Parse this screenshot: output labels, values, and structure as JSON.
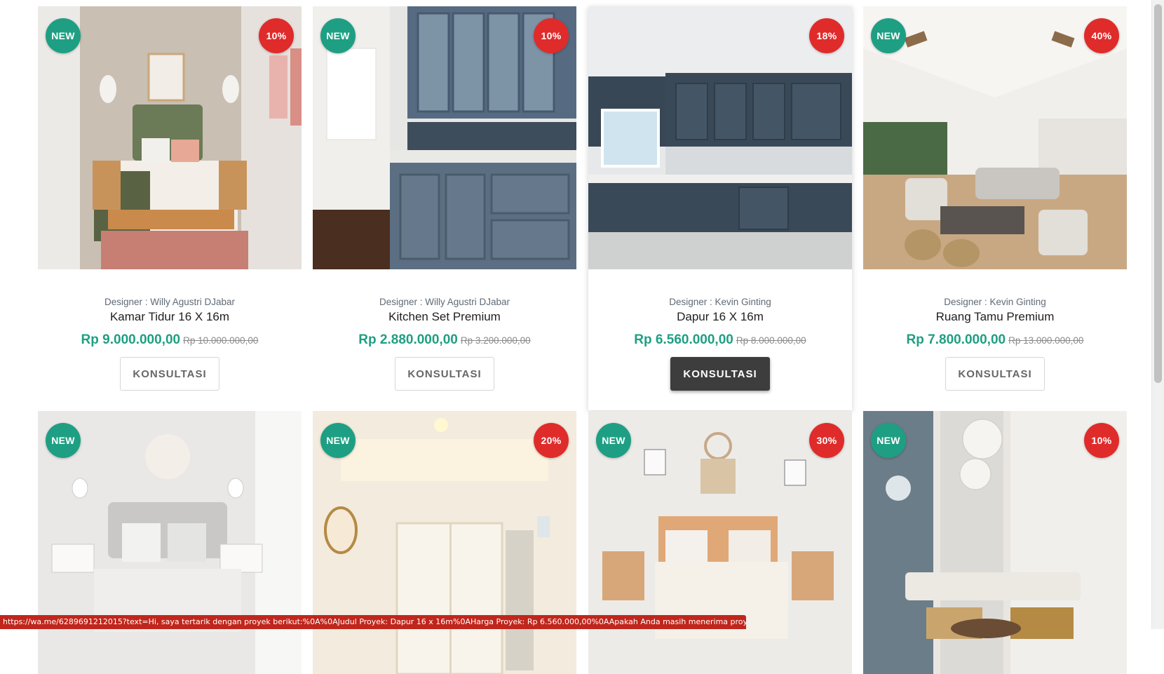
{
  "cards": [
    {
      "badge_new": "NEW",
      "badge_discount": "10%",
      "designer_prefix": "Designer :",
      "designer_name": "Willy Agustri DJabar",
      "name": "Kamar Tidur 16 X 16m",
      "price": "Rp 9.000.000,00",
      "old_price": "Rp 10.000.000,00",
      "button": "KONSULTASI",
      "image": "bedroom-pink"
    },
    {
      "badge_new": "NEW",
      "badge_discount": "10%",
      "designer_prefix": "Designer :",
      "designer_name": "Willy Agustri DJabar",
      "name": "Kitchen Set Premium",
      "price": "Rp 2.880.000,00",
      "old_price": "Rp 3.200.000,00",
      "button": "KONSULTASI",
      "image": "kitchen-blue-cabinets"
    },
    {
      "badge_new": "",
      "badge_discount": "18%",
      "designer_prefix": "Designer :",
      "designer_name": "Kevin Ginting",
      "name": "Dapur 16 X 16m",
      "price": "Rp 6.560.000,00",
      "old_price": "Rp 8.000.000,00",
      "button": "KONSULTASI",
      "image": "kitchen-navy"
    },
    {
      "badge_new": "NEW",
      "badge_discount": "40%",
      "designer_prefix": "Designer :",
      "designer_name": "Kevin Ginting",
      "name": "Ruang Tamu Premium",
      "price": "Rp 7.800.000,00",
      "old_price": "Rp 13.000.000,00",
      "button": "KONSULTASI",
      "image": "living-room-bright"
    },
    {
      "badge_new": "NEW",
      "badge_discount": "",
      "image": "bedroom-white"
    },
    {
      "badge_new": "NEW",
      "badge_discount": "20%",
      "image": "hallway-cream"
    },
    {
      "badge_new": "NEW",
      "badge_discount": "30%",
      "image": "bedroom-boho"
    },
    {
      "badge_new": "NEW",
      "badge_discount": "10%",
      "image": "living-room-chandelier"
    }
  ],
  "status_url": "https://wa.me/6289691212015?text=Hi, saya tertarik dengan proyek berikut:%0A%0AJudul Proyek: Dapur 16 x 16m%0AHarga Proyek: Rp 6.560.000,00%0AApakah Anda masih menerima proyek ini?",
  "colors": {
    "accent": "#1e9f83",
    "discount": "#e02b2b",
    "button_active": "#3d3d3d",
    "statusbar": "#c0261c"
  }
}
